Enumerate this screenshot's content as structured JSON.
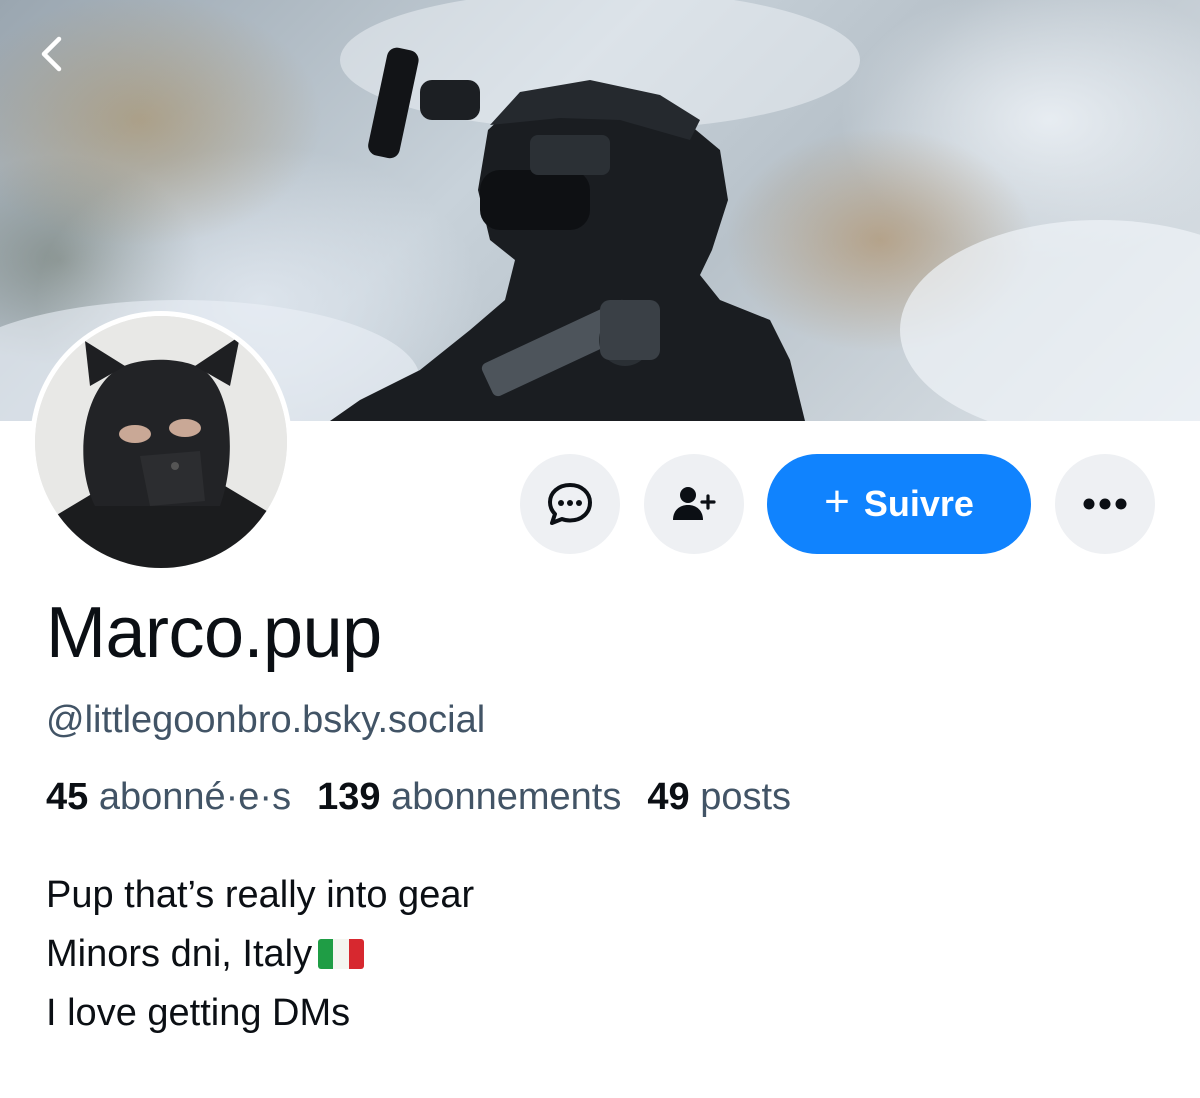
{
  "profile": {
    "display_name": "Marco.pup",
    "handle": "@littlegoonbro.bsky.social",
    "stats": {
      "followers_count": "45",
      "followers_label": "abonné·e·s",
      "following_count": "139",
      "following_label": "abonnements",
      "posts_count": "49",
      "posts_label": "posts"
    },
    "bio": {
      "line1": "Pup that’s really into gear",
      "line2": "Minors dni, Italy",
      "line3": "I love getting DMs"
    }
  },
  "actions": {
    "message_icon": "chat-bubble-icon",
    "add_user_icon": "person-plus-icon",
    "follow_label": "Suivre",
    "follow_plus": "+",
    "more_icon": "ellipsis-icon"
  },
  "nav": {
    "back_icon": "chevron-left-icon"
  },
  "colors": {
    "accent": "#1083fe",
    "secondary_text": "#425466",
    "button_bg": "#eef0f3"
  }
}
